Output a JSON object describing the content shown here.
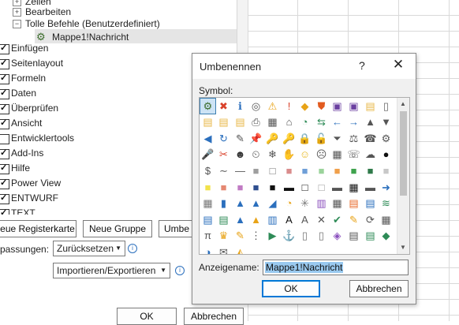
{
  "tree": {
    "items": [
      {
        "label": "Zellen",
        "type": "expander",
        "expander": "+"
      },
      {
        "label": "Bearbeiten",
        "type": "expander",
        "expander": "+"
      },
      {
        "label": "Tolle Befehle (Benutzerdefiniert)",
        "type": "expander",
        "expander": "−"
      },
      {
        "label": "Mappe1!Nachricht",
        "type": "command",
        "selected": true
      },
      {
        "label": "Einfügen",
        "checked": true
      },
      {
        "label": "Seitenlayout",
        "checked": true
      },
      {
        "label": "Formeln",
        "checked": true
      },
      {
        "label": "Daten",
        "checked": true
      },
      {
        "label": "Überprüfen",
        "checked": true
      },
      {
        "label": "Ansicht",
        "checked": true
      },
      {
        "label": "Entwicklertools",
        "checked": false
      },
      {
        "label": "Add-Ins",
        "checked": true
      },
      {
        "label": "Hilfe",
        "checked": true
      },
      {
        "label": "Power View",
        "checked": true
      },
      {
        "label": "ENTWURF",
        "checked": true
      },
      {
        "label": "TEXT",
        "checked": true
      }
    ]
  },
  "buttons": {
    "new_tab": "eue Registerkarte",
    "new_group": "Neue Gruppe",
    "rename": "Umbe",
    "ok_bottom": "OK",
    "cancel_bottom": "Abbrechen"
  },
  "customizations": {
    "label": "passungen:",
    "reset_value": "Zurücksetzen",
    "import_export_value": "Importieren/Exportieren"
  },
  "dialog": {
    "title": "Umbenennen",
    "help": "?",
    "close": "✕",
    "symbol_label": "Symbol:",
    "display_name_label": "Anzeigename:",
    "display_name_value": "Mappe1!Nachricht",
    "ok": "OK",
    "cancel": "Abbrechen"
  },
  "icons": [
    {
      "glyph": "⚙",
      "name": "org-chart-icon",
      "color": "#3a6b2a",
      "selected": true
    },
    {
      "glyph": "✖",
      "name": "cancel-circle-icon",
      "color": "#d9412a"
    },
    {
      "glyph": "ℹ",
      "name": "info-icon",
      "color": "#2b6fbd"
    },
    {
      "glyph": "◎",
      "name": "record-icon",
      "color": "#555555"
    },
    {
      "glyph": "⚠",
      "name": "warning-icon",
      "color": "#e8a317"
    },
    {
      "glyph": "!",
      "name": "exclamation-icon",
      "color": "#d9412a"
    },
    {
      "glyph": "◆",
      "name": "alert-diamond-icon",
      "color": "#e8a317"
    },
    {
      "glyph": "⛊",
      "name": "shield-icon",
      "color": "#e25b20"
    },
    {
      "glyph": "▣",
      "name": "save-icon",
      "color": "#6a3fa0"
    },
    {
      "glyph": "▣",
      "name": "save-all-icon",
      "color": "#6a3fa0"
    },
    {
      "glyph": "▤",
      "name": "folder-icon",
      "color": "#e8b84a"
    },
    {
      "glyph": "▯",
      "name": "new-document-icon",
      "color": "#666666"
    },
    {
      "glyph": "▤",
      "name": "open-folder-icon",
      "color": "#e8b84a"
    },
    {
      "glyph": "▤",
      "name": "folder-2-icon",
      "color": "#e8b84a"
    },
    {
      "glyph": "▤",
      "name": "folder-3-icon",
      "color": "#e8b84a"
    },
    {
      "glyph": "⎙",
      "name": "print-icon",
      "color": "#555555"
    },
    {
      "glyph": "▦",
      "name": "print-preview-icon",
      "color": "#555555"
    },
    {
      "glyph": "⌂",
      "name": "home-icon",
      "color": "#555555"
    },
    {
      "glyph": "◔",
      "name": "pie-icon",
      "color": "#2e8b57"
    },
    {
      "glyph": "⇆",
      "name": "swap-icon",
      "color": "#2e8b57"
    },
    {
      "glyph": "←",
      "name": "back-icon",
      "color": "#2b6fbd"
    },
    {
      "glyph": "→",
      "name": "forward-icon",
      "color": "#2b6fbd"
    },
    {
      "glyph": "▲",
      "name": "up-icon",
      "color": "#555555"
    },
    {
      "glyph": "▼",
      "name": "down-icon",
      "color": "#555555"
    },
    {
      "glyph": "◀",
      "name": "left-circle-icon",
      "color": "#2b6fbd"
    },
    {
      "glyph": "↻",
      "name": "refresh-icon",
      "color": "#2b6fbd"
    },
    {
      "glyph": "✎",
      "name": "edit-icon",
      "color": "#555555"
    },
    {
      "glyph": "📌",
      "name": "pin-icon",
      "color": "#555555"
    },
    {
      "glyph": "🔑",
      "name": "key-icon",
      "color": "#555555"
    },
    {
      "glyph": "🔑",
      "name": "key-2-icon",
      "color": "#555555"
    },
    {
      "glyph": "🔒",
      "name": "lock-icon",
      "color": "#555555"
    },
    {
      "glyph": "🔓",
      "name": "unlock-icon",
      "color": "#555555"
    },
    {
      "glyph": "⏷",
      "name": "filter-icon",
      "color": "#555555"
    },
    {
      "glyph": "⚖",
      "name": "scale-icon",
      "color": "#555555"
    },
    {
      "glyph": "☎",
      "name": "phone-icon",
      "color": "#555555"
    },
    {
      "glyph": "⚙",
      "name": "gear-icon",
      "color": "#555555"
    },
    {
      "glyph": "🎤",
      "name": "microphone-icon",
      "color": "#555555"
    },
    {
      "glyph": "✂",
      "name": "scissors-icon",
      "color": "#d9412a"
    },
    {
      "glyph": "☻",
      "name": "user-icon",
      "color": "#333333"
    },
    {
      "glyph": "⏲",
      "name": "timer-icon",
      "color": "#555555"
    },
    {
      "glyph": "❄",
      "name": "snowflake-icon",
      "color": "#555555"
    },
    {
      "glyph": "✋",
      "name": "hand-icon",
      "color": "#555555"
    },
    {
      "glyph": "☺",
      "name": "smiley-icon",
      "color": "#e8b820"
    },
    {
      "glyph": "☹",
      "name": "sad-icon",
      "color": "#555555"
    },
    {
      "glyph": "▦",
      "name": "calculator-icon",
      "color": "#555555"
    },
    {
      "glyph": "☏",
      "name": "handset-icon",
      "color": "#555555"
    },
    {
      "glyph": "☁",
      "name": "thought-bubble-icon",
      "color": "#555555"
    },
    {
      "glyph": "●",
      "name": "eight-ball-icon",
      "color": "#111111"
    },
    {
      "glyph": "$",
      "name": "dollar-icon",
      "color": "#555555"
    },
    {
      "glyph": "∼",
      "name": "eye-icon",
      "color": "#555555"
    },
    {
      "glyph": "—",
      "name": "line-icon",
      "color": "#555555"
    },
    {
      "glyph": "■",
      "name": "swatch-gray-icon",
      "color": "#9e9e9e"
    },
    {
      "glyph": "□",
      "name": "swatch-white-icon",
      "color": "#777777"
    },
    {
      "glyph": "■",
      "name": "swatch-rose-icon",
      "color": "#d98c8c"
    },
    {
      "glyph": "■",
      "name": "swatch-blue-icon",
      "color": "#6f9fd8"
    },
    {
      "glyph": "■",
      "name": "swatch-lightgreen-icon",
      "color": "#9bd39b"
    },
    {
      "glyph": "■",
      "name": "swatch-orange-icon",
      "color": "#f0a04b"
    },
    {
      "glyph": "■",
      "name": "swatch-green-icon",
      "color": "#3fa34d"
    },
    {
      "glyph": "■",
      "name": "swatch-darkgreen-icon",
      "color": "#2f7a4a"
    },
    {
      "glyph": "■",
      "name": "swatch-lightgray-icon",
      "color": "#c8c8c8"
    },
    {
      "glyph": "■",
      "name": "swatch-yellow-icon",
      "color": "#f2e24b"
    },
    {
      "glyph": "■",
      "name": "swatch-salmon-icon",
      "color": "#e58872"
    },
    {
      "glyph": "■",
      "name": "swatch-violet-icon",
      "color": "#c17bc4"
    },
    {
      "glyph": "■",
      "name": "swatch-navy-icon",
      "color": "#2f4f8f"
    },
    {
      "glyph": "■",
      "name": "swatch-black-icon",
      "color": "#111111"
    },
    {
      "glyph": "▬",
      "name": "border-top-icon",
      "color": "#111111"
    },
    {
      "glyph": "□",
      "name": "border-box-icon",
      "color": "#111111"
    },
    {
      "glyph": "□",
      "name": "border-empty-icon",
      "color": "#999999"
    },
    {
      "glyph": "▬",
      "name": "border-bottom-icon",
      "color": "#555555"
    },
    {
      "glyph": "▦",
      "name": "border-grid-icon",
      "color": "#111111"
    },
    {
      "glyph": "▬",
      "name": "border-thick-icon",
      "color": "#555555"
    },
    {
      "glyph": "➜",
      "name": "arrow-circle-icon",
      "color": "#2b6fbd"
    },
    {
      "glyph": "▦",
      "name": "table-icon",
      "color": "#777777"
    },
    {
      "glyph": "▮",
      "name": "bar-chart-icon",
      "color": "#2b6fbd"
    },
    {
      "glyph": "▲",
      "name": "cone-icon",
      "color": "#2b6fbd"
    },
    {
      "glyph": "▲",
      "name": "mountains-icon",
      "color": "#2b6fbd"
    },
    {
      "glyph": "◢",
      "name": "area-chart-icon",
      "color": "#2b6fbd"
    },
    {
      "glyph": "◔",
      "name": "pie-chart-icon",
      "color": "#e8a317"
    },
    {
      "glyph": "✳",
      "name": "radar-icon",
      "color": "#777777"
    },
    {
      "glyph": "▥",
      "name": "columns-icon",
      "color": "#8a4fbd"
    },
    {
      "glyph": "▦",
      "name": "grid-icon",
      "color": "#555555"
    },
    {
      "glyph": "▤",
      "name": "sheet-orange-icon",
      "color": "#e86a2a"
    },
    {
      "glyph": "▤",
      "name": "sheet-blue-icon",
      "color": "#2b6fbd"
    },
    {
      "glyph": "≋",
      "name": "wave-chart-icon",
      "color": "#2e8b57"
    },
    {
      "glyph": "▤",
      "name": "sheet-icon",
      "color": "#2b6fbd"
    },
    {
      "glyph": "▤",
      "name": "sheet-2-icon",
      "color": "#2e8b57"
    },
    {
      "glyph": "▲",
      "name": "mountain-chart-icon",
      "color": "#2b6fbd"
    },
    {
      "glyph": "▲",
      "name": "mountain-chart-2-icon",
      "color": "#e8a317"
    },
    {
      "glyph": "▥",
      "name": "stacked-chart-icon",
      "color": "#2b6fbd"
    },
    {
      "glyph": "A",
      "name": "text-box-icon",
      "color": "#111111"
    },
    {
      "glyph": "A",
      "name": "font-color-icon",
      "color": "#555555"
    },
    {
      "glyph": "✕",
      "name": "delete-icon",
      "color": "#555555"
    },
    {
      "glyph": "✔",
      "name": "check-icon",
      "color": "#2e8b57"
    },
    {
      "glyph": "✎",
      "name": "pencil-icon",
      "color": "#e8a317"
    },
    {
      "glyph": "⟳",
      "name": "rotate-icon",
      "color": "#555555"
    },
    {
      "glyph": "▦",
      "name": "calendar-icon",
      "color": "#555555"
    },
    {
      "glyph": "π",
      "name": "pi-icon",
      "color": "#555555"
    },
    {
      "glyph": "♛",
      "name": "fill-bucket-icon",
      "color": "#e8a317"
    },
    {
      "glyph": "✎",
      "name": "highlighter-icon",
      "color": "#e8a317"
    },
    {
      "glyph": "⋮",
      "name": "list-icon",
      "color": "#555555"
    },
    {
      "glyph": "▶",
      "name": "play-icon",
      "color": "#2e8b57"
    },
    {
      "glyph": "⚓",
      "name": "anchor-icon",
      "color": "#2b6fbd"
    },
    {
      "glyph": "▯",
      "name": "document-icon",
      "color": "#777777"
    },
    {
      "glyph": "▯",
      "name": "document-2-icon",
      "color": "#777777"
    },
    {
      "glyph": "◈",
      "name": "shapes-icon",
      "color": "#8a4fbd"
    },
    {
      "glyph": "▤",
      "name": "sheet-3-icon",
      "color": "#555555"
    },
    {
      "glyph": "▤",
      "name": "sheet-4-icon",
      "color": "#2e8b57"
    },
    {
      "glyph": "◆",
      "name": "color-diamond-icon",
      "color": "#2e8b57"
    },
    {
      "glyph": "◑",
      "name": "shade-icon",
      "color": "#2b6fbd"
    },
    {
      "glyph": "✉",
      "name": "mail-icon",
      "color": "#555555"
    },
    {
      "glyph": "◭",
      "name": "triangle-icon",
      "color": "#e8a317"
    }
  ]
}
